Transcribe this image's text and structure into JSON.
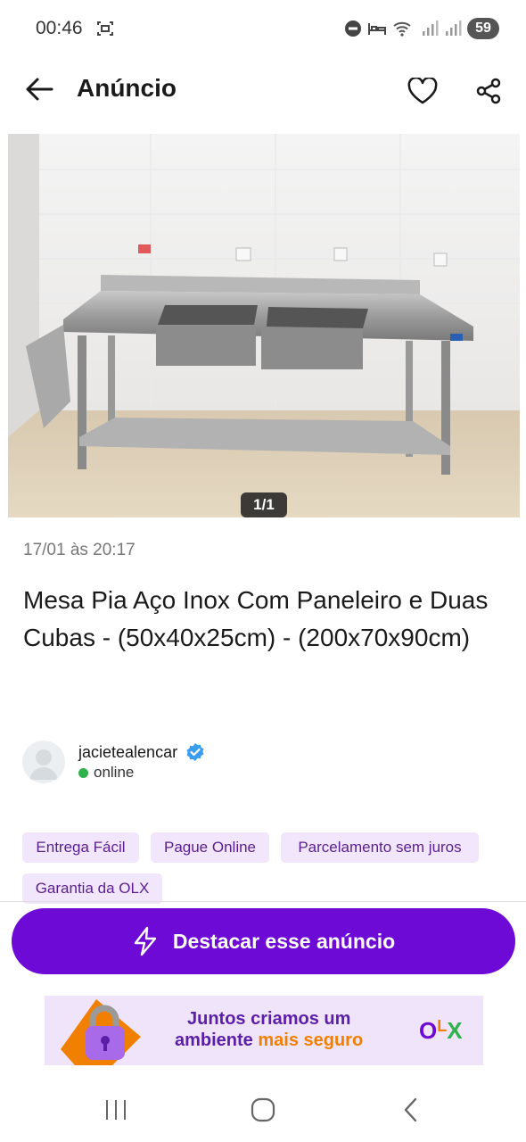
{
  "status_bar": {
    "time": "00:46",
    "battery": "59"
  },
  "header": {
    "title": "Anúncio"
  },
  "photo": {
    "counter": "1/1"
  },
  "listing": {
    "date": "17/01 às 20:17",
    "title": "Mesa Pia Aço Inox Com Paneleiro e Duas Cubas - (50x40x25cm) - (200x70x90cm)"
  },
  "seller": {
    "name": "jacietealencar",
    "status": "online"
  },
  "tags": [
    "Entrega Fácil",
    "Pague Online",
    "Parcelamento sem juros",
    "Garantia da OLX"
  ],
  "cta": {
    "label": "Destacar esse anúncio"
  },
  "banner": {
    "line1": "Juntos criamos um",
    "line2_plain": "ambiente ",
    "line2_accent": "mais seguro",
    "logo": {
      "o": "O",
      "l": "L",
      "x": "X"
    }
  },
  "colors": {
    "brand_purple": "#6e0ad6",
    "accent_orange": "#f28000",
    "online_green": "#2fb24c",
    "tag_bg": "#f1e6fb"
  }
}
